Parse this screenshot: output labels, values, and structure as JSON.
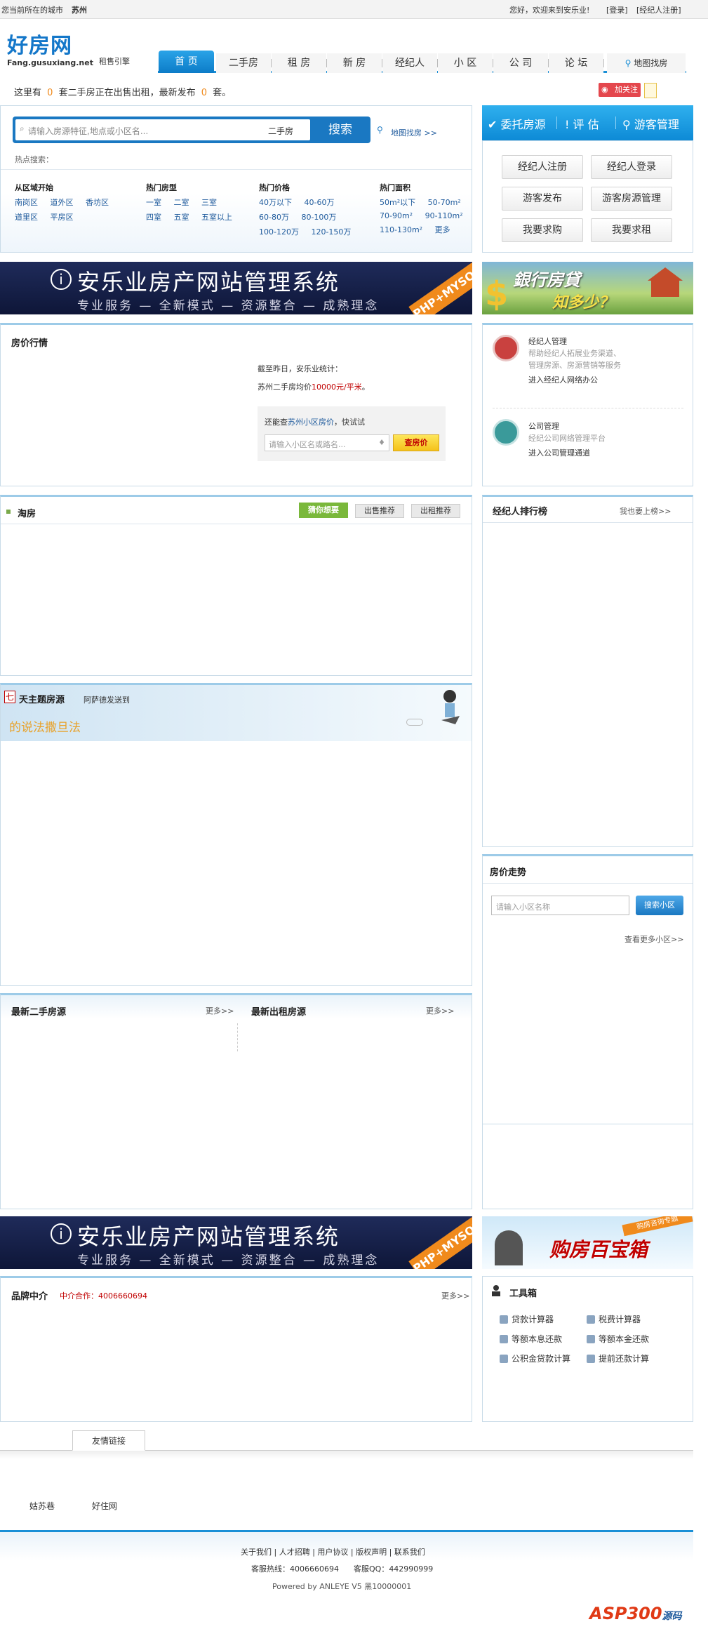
{
  "topbar": {
    "city_label": "您当前所在的城市",
    "city": "苏州",
    "welcome": "您好，欢迎来到安乐业!",
    "login": "[登录]",
    "agent_register": "[经纪人注册]"
  },
  "logo": {
    "main": "好房网",
    "sub": "Fang.gusuxiang.net",
    "engine": "租售引擎"
  },
  "nav": [
    "首 页",
    "二手房",
    "租 房",
    "新 房",
    "经纪人",
    "小 区",
    "公 司",
    "论 坛"
  ],
  "map_link": "地图找房",
  "stats": {
    "prefix": "这里有",
    "count1": "0",
    "middle": "套二手房正在出售出租，最新发布",
    "count2": "0",
    "suffix": "套。"
  },
  "follow": "加关注",
  "search": {
    "placeholder": "请输入房源特征,地点或小区名...",
    "type": "二手房",
    "button": "搜索",
    "map": "地图找房 >>",
    "hot_label": "热点搜索："
  },
  "filters": [
    {
      "title": "从区域开始",
      "rows": [
        [
          "南岗区",
          "道外区",
          "香坊区"
        ],
        [
          "道里区",
          "平房区"
        ]
      ]
    },
    {
      "title": "热门房型",
      "rows": [
        [
          "一室",
          "二室",
          "三室"
        ],
        [
          "四室",
          "五室",
          "五室以上"
        ]
      ]
    },
    {
      "title": "热门价格",
      "rows": [
        [
          "40万以下",
          "40-60万"
        ],
        [
          "60-80万",
          "80-100万"
        ],
        [
          "100-120万",
          "120-150万"
        ]
      ]
    },
    {
      "title": "热门面积",
      "rows": [
        [
          "50m²以下",
          "50-70m²"
        ],
        [
          "70-90m²",
          "90-110m²"
        ],
        [
          "110-130m²",
          "更多"
        ]
      ]
    }
  ],
  "side_tabs": [
    "委托房源",
    "评 估",
    "游客管理"
  ],
  "side_buttons": [
    "经纪人注册",
    "经纪人登录",
    "游客发布",
    "游客房源管理",
    "我要求购",
    "我要求租"
  ],
  "banner": {
    "title": "安乐业房产网站管理系统",
    "sub": "专业服务 — 全新模式 — 资源整合 — 成熟理念",
    "tag": "PHP+MYSQL"
  },
  "ad1": {
    "line1": "銀行房貸",
    "line2": "知多少？"
  },
  "price": {
    "title": "房价行情",
    "line1": "截至昨日，安乐业统计：",
    "line2_pre": "苏州二手房均价",
    "line2_val": "10000元/平米",
    "line2_suf": "。",
    "query_pre": "还能查",
    "query_city": "苏州小区房价",
    "query_suf": "，快试试",
    "placeholder": "请输入小区名或路名...",
    "button": "查房价"
  },
  "agent_mgmt": {
    "title": "经纪人管理",
    "desc1": "帮助经纪人拓展业务渠道、",
    "desc2": "管理房源、房源营销等服务",
    "link": "进入经纪人网络办公"
  },
  "company_mgmt": {
    "title": "公司管理",
    "desc": "经纪公司网络管理平台",
    "link": "进入公司管理通道"
  },
  "taofang": {
    "title": "淘房",
    "tabs": [
      "猜你想要",
      "出售推荐",
      "出租推荐"
    ]
  },
  "ranking": {
    "title": "经纪人排行榜",
    "link": "我也要上榜>>"
  },
  "theme": {
    "title": "天主题房源",
    "sub": "阿萨德发送到",
    "slogan": "的说法撒旦法",
    "badge": "七"
  },
  "trend": {
    "title": "房价走势",
    "placeholder": "请输入小区名称",
    "button": "搜索小区",
    "more": "查看更多小区>>"
  },
  "latest_sale": {
    "title": "最新二手房源",
    "more": "更多>>"
  },
  "latest_rent": {
    "title": "最新出租房源",
    "more": "更多>>"
  },
  "ad2": {
    "tag": "购房咨询专题",
    "text": "购房百宝箱"
  },
  "brand": {
    "title": "品牌中介",
    "coop": "中介合作：4006660694",
    "more": "更多>>"
  },
  "toolbox": {
    "title": "工具箱",
    "items": [
      "贷款计算器",
      "税费计算器",
      "等额本息还款",
      "等额本金还款",
      "公积金贷款计算",
      "提前还款计算"
    ]
  },
  "links": {
    "tab": "友情链接",
    "items": [
      "姑苏巷",
      "好住网"
    ]
  },
  "footer": {
    "links": [
      "关于我们",
      "人才招聘",
      "用户协议",
      "版权声明",
      "联系我们"
    ],
    "hotline_label": "客服热线：",
    "hotline": "4006660694",
    "qq_label": "客服QQ：",
    "qq": "442990999",
    "powered": "Powered by ANLEYE V5 黑10000001"
  },
  "watermark": {
    "asp": "ASP300",
    "code": "源码"
  },
  "colors": {
    "brand": "#1477c9",
    "nav_active": "#1a8fd6",
    "accent_orange": "#f08a1c",
    "price_red": "#c00000"
  }
}
